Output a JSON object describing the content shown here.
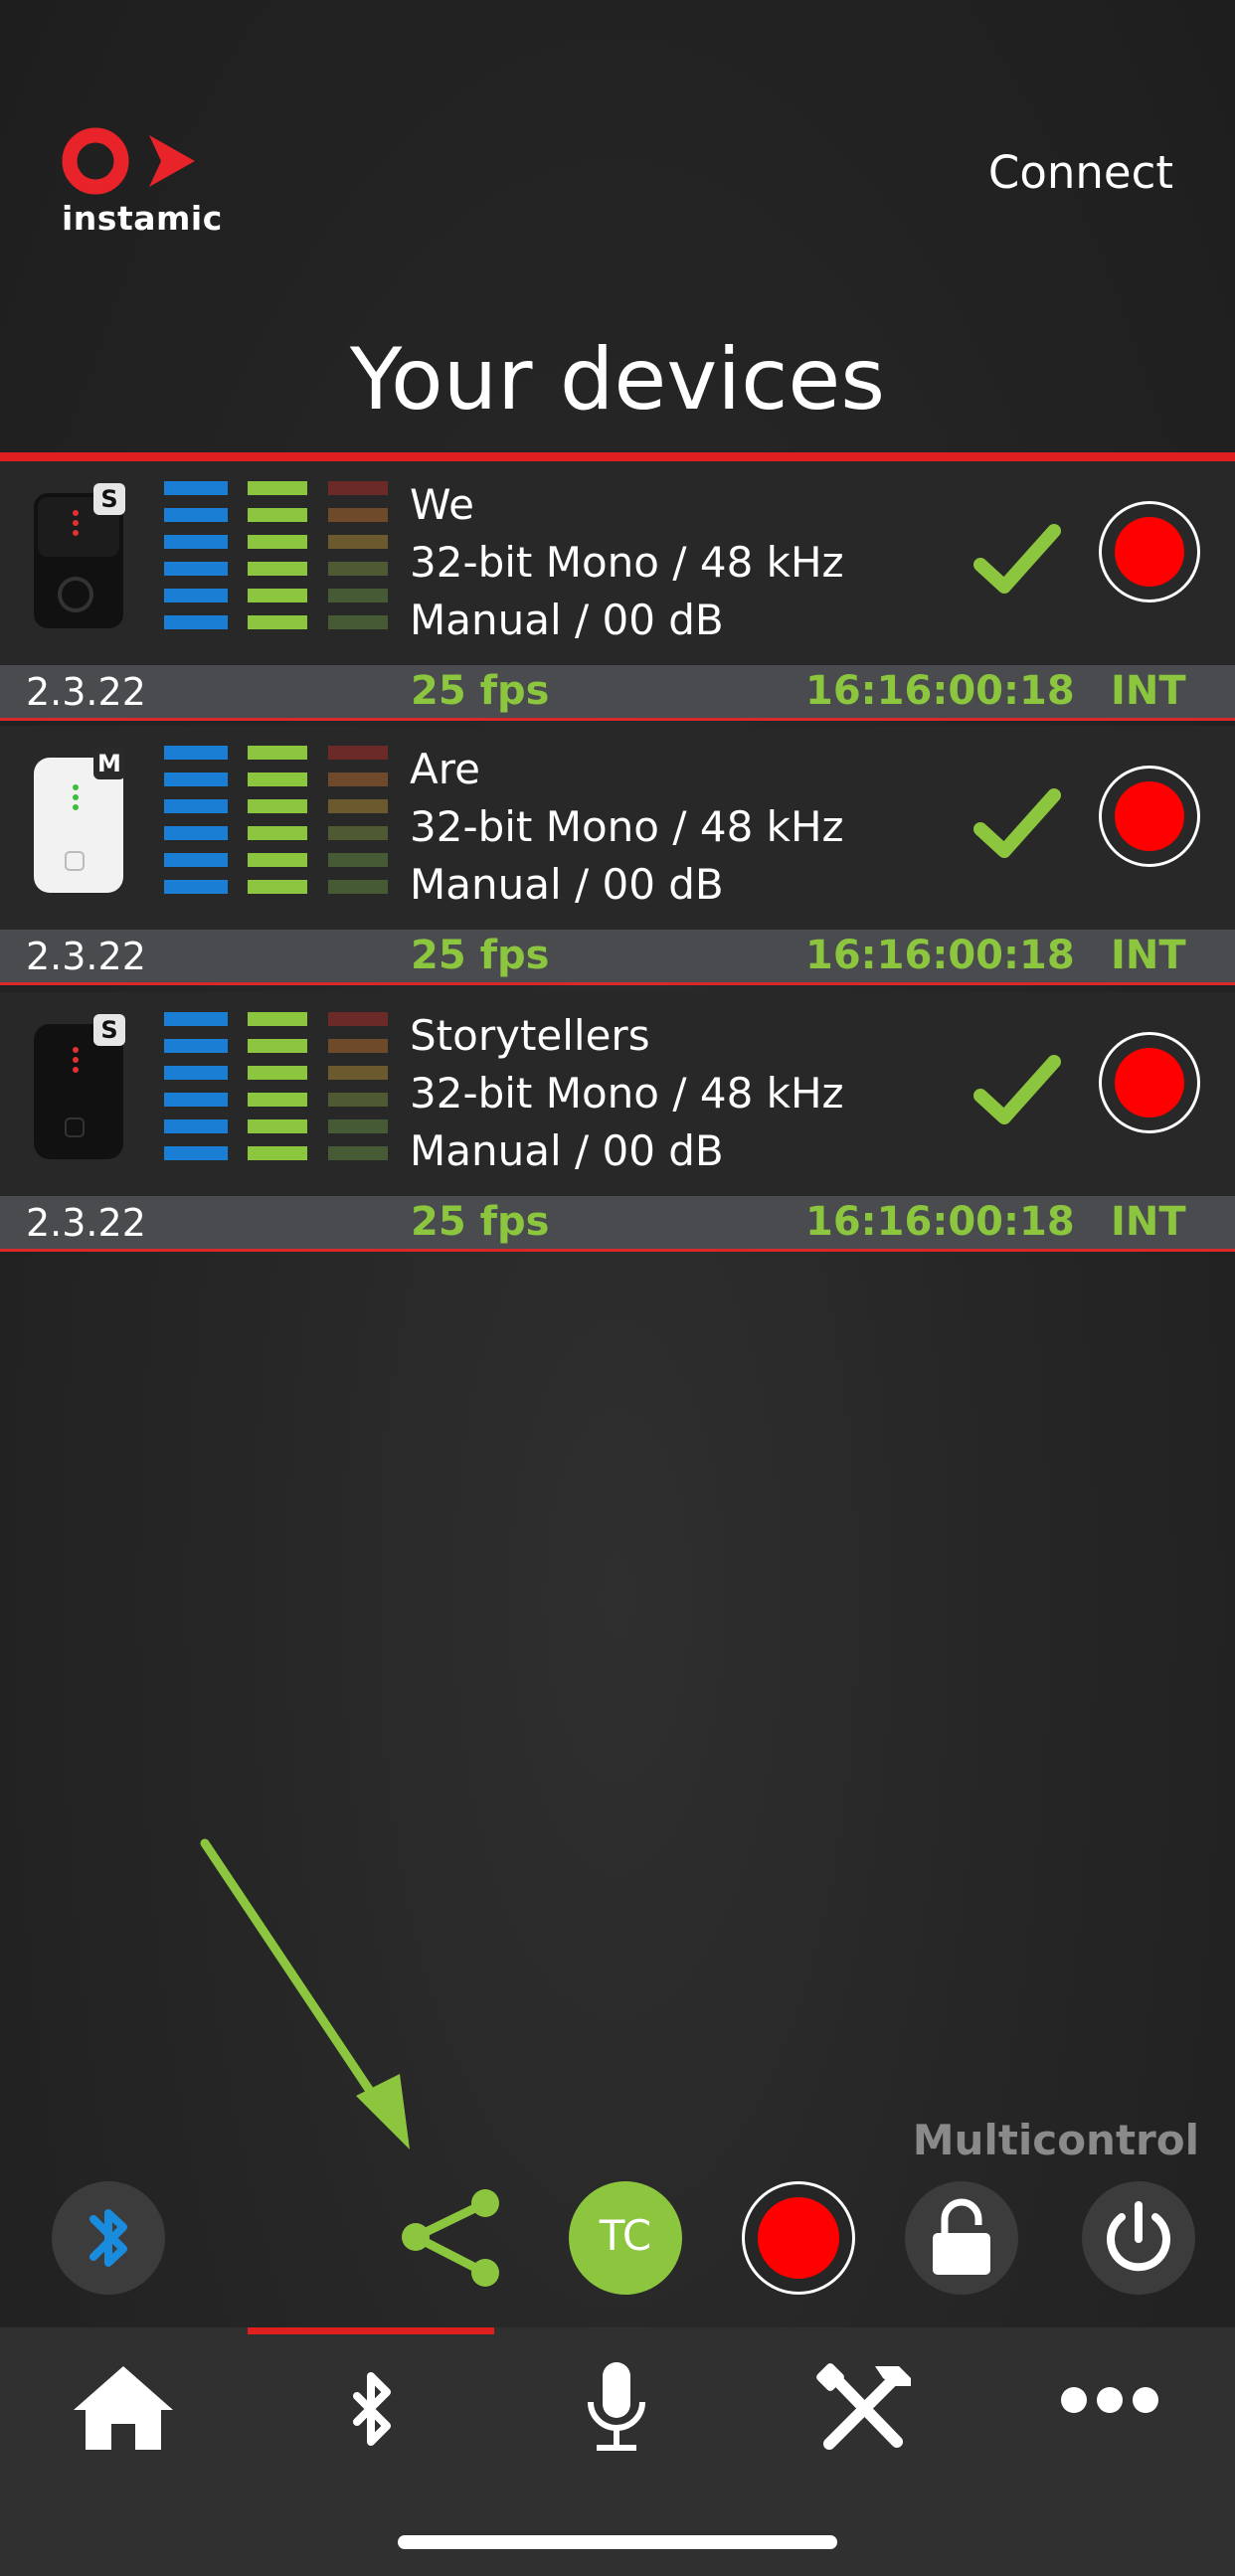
{
  "header": {
    "logo_text": "instamic",
    "connect_label": "Connect",
    "title": "Your devices"
  },
  "devices": [
    {
      "name": "We",
      "format": "32-bit Mono / 48 kHz",
      "gain": "Manual / 00 dB",
      "badge": "S",
      "model": "black-pro",
      "firmware": "2.3.22",
      "fps": "25 fps",
      "timecode": "16:16:00:18",
      "tc_source": "INT"
    },
    {
      "name": "Are",
      "format": "32-bit Mono / 48 kHz",
      "gain": "Manual / 00 dB",
      "badge": "M",
      "model": "white-mini",
      "firmware": "2.3.22",
      "fps": "25 fps",
      "timecode": "16:16:00:18",
      "tc_source": "INT"
    },
    {
      "name": "Storytellers",
      "format": "32-bit Mono / 48 kHz",
      "gain": "Manual / 00 dB",
      "badge": "S",
      "model": "black-mini",
      "firmware": "2.3.22",
      "fps": "25 fps",
      "timecode": "16:16:00:18",
      "tc_source": "INT"
    }
  ],
  "multicontrol": {
    "label": "Multicontrol",
    "tc_label": "TC",
    "buttons": [
      "bluetooth-icon",
      "share-icon",
      "timecode-icon",
      "record-icon",
      "unlock-icon",
      "power-icon"
    ]
  },
  "bottom_nav": {
    "items": [
      "home-icon",
      "bluetooth-icon",
      "microphone-icon",
      "tools-icon",
      "more-icon"
    ],
    "active": "bluetooth-icon"
  },
  "colors": {
    "accent_red": "#e02020",
    "green": "#8cc63f",
    "blue": "#1a7fd4",
    "record_red": "#ff0000"
  }
}
